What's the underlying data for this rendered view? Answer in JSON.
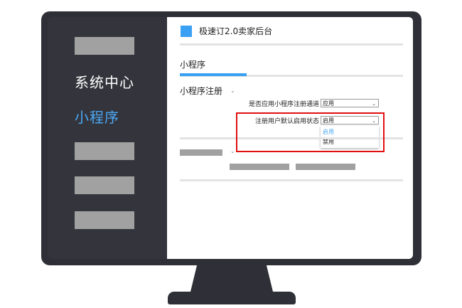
{
  "app": {
    "title": "极速订2.0卖家后台",
    "brand_color": "#3aa0f3"
  },
  "sidebar": {
    "items": [
      {
        "label": "系统中心",
        "color": "#ffffff",
        "active": false
      },
      {
        "label": "小程序",
        "color": "#4aa8f5",
        "active": true
      }
    ]
  },
  "main": {
    "tab": {
      "label": "小程序"
    },
    "section": {
      "label": "小程序注册"
    },
    "settings": [
      {
        "label": "是否应用小程序注册通道",
        "value": "应用"
      },
      {
        "label": "注册用户默认启用状态",
        "value": "启用"
      }
    ],
    "dropdown_options": [
      {
        "label": "启用",
        "color": "#4aa8f5"
      },
      {
        "label": "禁用",
        "color": "#222222"
      }
    ]
  },
  "annotation": {
    "color": "#e01010"
  }
}
